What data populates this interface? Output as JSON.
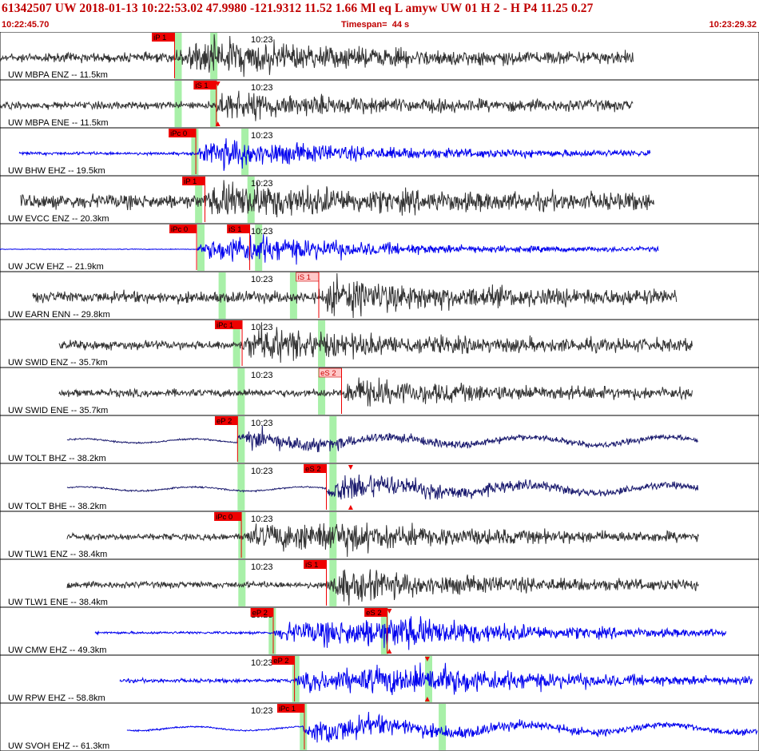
{
  "header": {
    "title": "61342507 UW 2018-01-13 10:22:53.02    47.9980 -121.9312  11.52  1.66 Ml  eq  L amyw      UW 01  H   2  -  H P4    11.25  0.27",
    "start_time": "10:22:45.70",
    "timespan_label": "Timespan=",
    "timespan_value": "44 s",
    "end_time": "10:23:29.32"
  },
  "colors": {
    "header_text": "#c00000",
    "trace_gray": "#333333",
    "trace_blue": "#0000ee",
    "trace_navy": "#1a1a6e",
    "pick_red": "#ee0000",
    "pick_light": "#ffc8c8",
    "window_green": "#a8f0a8",
    "amp_marker": "#ee0000"
  },
  "chart_data": {
    "type": "seismogram",
    "time_range": [
      "10:22:45.70",
      "10:23:29.32"
    ],
    "timespan_s": 44,
    "time_tick_label": "10:23",
    "grid": false,
    "channels": [
      {
        "label": "UW MBPA ENZ -- 11.5km",
        "color": "gray",
        "data_start": 0.0,
        "data_end": 0.835,
        "onset": 0.23,
        "amp": 0.35,
        "picks": [
          {
            "phase": "iP 1",
            "t": 0.23,
            "style": "strong"
          }
        ],
        "windows": [
          0.23,
          0.277
        ],
        "peak": [
          0.29,
          1.0
        ]
      },
      {
        "label": "UW MBPA ENE -- 11.5km",
        "color": "gray",
        "data_start": 0.0,
        "data_end": 0.835,
        "onset": 0.28,
        "amp": 0.28,
        "picks": [
          {
            "phase": "iS 1",
            "t": 0.285,
            "style": "strong"
          }
        ],
        "windows": [
          0.23,
          0.277
        ],
        "peak": [
          0.29,
          0.8
        ],
        "amp_marker": [
          0.287
        ]
      },
      {
        "label": "UW BHW EHZ -- 19.5km",
        "color": "blue",
        "data_start": 0.025,
        "data_end": 0.858,
        "onset": 0.258,
        "amp": 0.12,
        "picks": [
          {
            "phase": "iPc 0",
            "t": 0.258,
            "style": "strong"
          }
        ],
        "windows": [
          0.252,
          0.318
        ],
        "peak": [
          0.3,
          0.9
        ]
      },
      {
        "label": "UW EVCC ENZ -- 20.3km",
        "color": "gray",
        "data_start": 0.027,
        "data_end": 0.862,
        "onset": 0.27,
        "amp": 0.55,
        "picks": [
          {
            "phase": "iP 1",
            "t": 0.27,
            "style": "strong"
          }
        ],
        "windows": [
          0.257,
          0.326
        ],
        "peak": [
          0.3,
          0.9
        ]
      },
      {
        "label": "UW JCW EHZ -- 21.9km",
        "color": "blue",
        "data_start": 0.0,
        "data_end": 0.867,
        "onset": 0.259,
        "amp": 0.03,
        "picks": [
          {
            "phase": "iPc 0",
            "t": 0.259,
            "style": "strong"
          },
          {
            "phase": "iS 1",
            "t": 0.329,
            "style": "strong"
          }
        ],
        "windows": [
          0.26,
          0.336
        ],
        "peak": [
          0.33,
          1.0
        ]
      },
      {
        "label": "UW EARN ENN -- 29.8km",
        "color": "gray",
        "data_start": 0.043,
        "data_end": 0.892,
        "onset": 0.42,
        "amp": 0.45,
        "picks": [
          {
            "phase": "iS 1",
            "t": 0.42,
            "style": "light"
          }
        ],
        "windows": [
          0.288,
          0.382
        ],
        "peak": [
          0.44,
          0.9
        ]
      },
      {
        "label": "UW SWID ENZ -- 35.7km",
        "color": "gray",
        "data_start": 0.078,
        "data_end": 0.913,
        "onset": 0.32,
        "amp": 0.35,
        "picks": [
          {
            "phase": "iPc 1",
            "t": 0.319,
            "style": "strong"
          }
        ],
        "windows": [
          0.307,
          0.419
        ],
        "peak": [
          0.33,
          1.0
        ]
      },
      {
        "label": "UW SWID ENE -- 35.7km",
        "color": "gray",
        "data_start": 0.078,
        "data_end": 0.913,
        "onset": 0.45,
        "amp": 0.3,
        "picks": [
          {
            "phase": "eS 2",
            "t": 0.45,
            "style": "light"
          }
        ],
        "windows": [
          0.313,
          0.419
        ],
        "peak": [
          0.45,
          0.8
        ]
      },
      {
        "label": "UW TOLT BHZ -- 38.2km",
        "color": "navy",
        "data_start": 0.088,
        "data_end": 0.92,
        "onset": 0.313,
        "amp": 0.08,
        "picks": [
          {
            "phase": "eP 2",
            "t": 0.313,
            "style": "strong"
          }
        ],
        "windows": [
          0.313,
          0.434
        ],
        "peak": [
          0.33,
          0.6
        ],
        "lowfreq": true
      },
      {
        "label": "UW TOLT BHE -- 38.2km",
        "color": "navy",
        "data_start": 0.088,
        "data_end": 0.92,
        "onset": 0.43,
        "amp": 0.08,
        "picks": [
          {
            "phase": "eS 2",
            "t": 0.43,
            "style": "strong"
          }
        ],
        "windows": [
          0.313,
          0.434
        ],
        "peak": [
          0.45,
          1.0
        ],
        "lowfreq": true,
        "amp_marker": [
          0.462
        ]
      },
      {
        "label": "UW TLW1 ENZ -- 38.4km",
        "color": "gray",
        "data_start": 0.088,
        "data_end": 0.921,
        "onset": 0.318,
        "amp": 0.25,
        "picks": [
          {
            "phase": "iPc 0",
            "t": 0.318,
            "style": "strong"
          }
        ],
        "windows": [
          0.314,
          0.434
        ],
        "peak": [
          0.44,
          0.9
        ]
      },
      {
        "label": "UW TLW1 ENE -- 38.4km",
        "color": "gray",
        "data_start": 0.088,
        "data_end": 0.921,
        "onset": 0.43,
        "amp": 0.25,
        "picks": [
          {
            "phase": "iS 1",
            "t": 0.43,
            "style": "strong"
          }
        ],
        "windows": [
          0.314,
          0.434
        ],
        "peak": [
          0.44,
          1.0
        ]
      },
      {
        "label": "UW CMW EHZ -- 49.3km",
        "color": "blue",
        "data_start": 0.125,
        "data_end": 0.957,
        "onset": 0.36,
        "amp": 0.1,
        "picks": [
          {
            "phase": "eP 2",
            "t": 0.36,
            "style": "strong"
          },
          {
            "phase": "eS 2",
            "t": 0.51,
            "style": "strong"
          }
        ],
        "windows": [
          0.354,
          0.502
        ],
        "peak": [
          0.54,
          1.0
        ],
        "amp_marker": [
          0.513
        ]
      },
      {
        "label": "UW RPW EHZ -- 58.8km",
        "color": "blue",
        "data_start": 0.158,
        "data_end": 0.992,
        "onset": 0.388,
        "amp": 0.15,
        "picks": [
          {
            "phase": "eP 2",
            "t": 0.388,
            "style": "strong"
          }
        ],
        "windows": [
          0.385,
          0.56
        ],
        "peak": [
          0.57,
          0.9
        ],
        "amp_marker": [
          0.563
        ]
      },
      {
        "label": "UW SVOH EHZ -- 61.3km",
        "color": "blue",
        "data_start": 0.167,
        "data_end": 0.998,
        "onset": 0.4,
        "amp": 0.5,
        "picks": [
          {
            "phase": "iPc 1",
            "t": 0.401,
            "style": "strong"
          }
        ],
        "windows": [
          0.395,
          0.578
        ],
        "peak": [
          0.42,
          1.0
        ],
        "lowfreq": true
      }
    ]
  }
}
